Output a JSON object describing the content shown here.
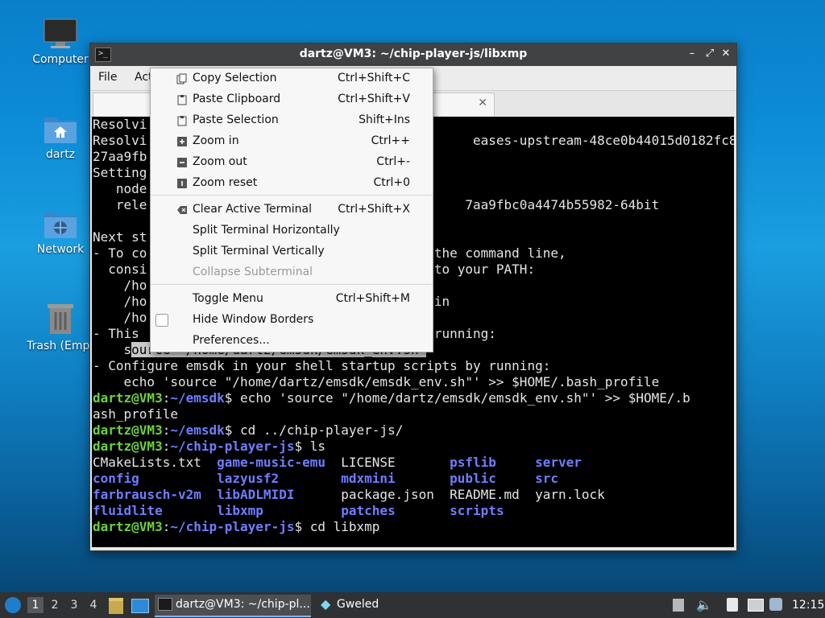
{
  "desktop": {
    "icons": [
      {
        "label": "Computer"
      },
      {
        "label": "dartz"
      },
      {
        "label": "Network"
      },
      {
        "label": "Trash (Empt"
      }
    ]
  },
  "window": {
    "title": "dartz@VM3: ~/chip-player-js/libxmp",
    "menus": [
      "File",
      "Act"
    ]
  },
  "terminal_lines": [
    "Resolvi",
    "Resolvi                                          eases-upstream-48ce0b44015d0182fc8",
    "27aa9fb",
    "Setting",
    "   node",
    "   rele                                         7aa9fbc0a4474b55982-64bit",
    "",
    "Next st",
    "- To co                                     the command line,",
    "  consi                                   s to your PATH:",
    "    /ho",
    "    /ho                                     in",
    "    /ho",
    "- This                                    y running:"
  ],
  "terminal_hl": {
    "pre": "    s",
    "text": "ource \"/home/dartz/emsdk/emsdk_env.sh\""
  },
  "terminal_lines2": [
    "- Configure emsdk in your shell startup scripts by running:",
    "    echo 'source \"/home/dartz/emsdk/emsdk_env.sh\"' >> $HOME/.bash_profile"
  ],
  "prompt": {
    "user": "dartz@VM3",
    "p1": "~/emsdk",
    "cmd1": "$ echo 'source \"/home/dartz/emsdk/emsdk_env.sh\"' >> $HOME/.b",
    "cmd1b": "ash_profile",
    "p2": "~/emsdk",
    "cmd2": "$ cd ../chip-player-js/",
    "p3": "~/chip-player-js",
    "cmd3": "$ ls",
    "p4": "~/chip-player-js",
    "cmd4": "$ cd libxmp"
  },
  "ls_rows": [
    [
      {
        "t": "CMakeLists.txt",
        "d": false
      },
      {
        "t": "game-music-emu",
        "d": true
      },
      {
        "t": "LICENSE",
        "d": false
      },
      {
        "t": "psflib",
        "d": true
      },
      {
        "t": "server",
        "d": true
      }
    ],
    [
      {
        "t": "config",
        "d": true
      },
      {
        "t": "lazyusf2",
        "d": true
      },
      {
        "t": "mdxmini",
        "d": true
      },
      {
        "t": "public",
        "d": true
      },
      {
        "t": "src",
        "d": true
      }
    ],
    [
      {
        "t": "farbrausch-v2m",
        "d": true
      },
      {
        "t": "libADLMIDI",
        "d": true
      },
      {
        "t": "package.json",
        "d": false
      },
      {
        "t": "README.md",
        "d": false
      },
      {
        "t": "yarn.lock",
        "d": false
      }
    ],
    [
      {
        "t": "fluidlite",
        "d": true
      },
      {
        "t": "libxmp",
        "d": true
      },
      {
        "t": "patches",
        "d": true
      },
      {
        "t": "scripts",
        "d": true
      },
      {
        "t": "",
        "d": false
      }
    ]
  ],
  "context_menu": {
    "items": [
      {
        "label": "Copy Selection",
        "shortcut": "Ctrl+Shift+C",
        "icon": "copy-icon"
      },
      {
        "label": "Paste Clipboard",
        "shortcut": "Ctrl+Shift+V",
        "icon": "paste-icon"
      },
      {
        "label": "Paste Selection",
        "shortcut": "Shift+Ins",
        "icon": "paste-icon"
      },
      {
        "label": "Zoom in",
        "shortcut": "Ctrl++",
        "icon": "zoom-in-icon"
      },
      {
        "label": "Zoom out",
        "shortcut": "Ctrl+-",
        "icon": "zoom-out-icon"
      },
      {
        "label": "Zoom reset",
        "shortcut": "Ctrl+0",
        "icon": "zoom-reset-icon"
      },
      {
        "label": "Clear Active Terminal",
        "shortcut": "Ctrl+Shift+X",
        "icon": "clear-icon"
      },
      {
        "label": "Split Terminal Horizontally",
        "shortcut": "",
        "icon": ""
      },
      {
        "label": "Split Terminal Vertically",
        "shortcut": "",
        "icon": ""
      },
      {
        "label": "Collapse Subterminal",
        "shortcut": "",
        "icon": "",
        "disabled": true
      },
      {
        "label": "Toggle Menu",
        "shortcut": "Ctrl+Shift+M",
        "icon": ""
      },
      {
        "label": "Hide Window Borders",
        "shortcut": "",
        "icon": "checkbox-icon",
        "checked": false
      },
      {
        "label": "Preferences...",
        "shortcut": "",
        "icon": ""
      }
    ]
  },
  "taskbar": {
    "workspaces": [
      "1",
      "2",
      "3",
      "4"
    ],
    "tasks": [
      {
        "label": "dartz@VM3: ~/chip-pl..."
      },
      {
        "label": "Gweled"
      }
    ],
    "clock": "12:15"
  }
}
